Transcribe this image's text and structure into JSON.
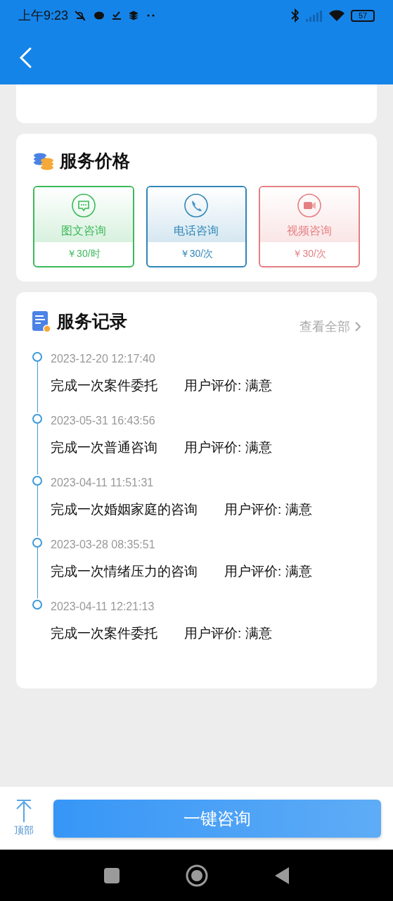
{
  "status_bar": {
    "time": "上午9:23",
    "battery": "57"
  },
  "price_section": {
    "title": "服务价格",
    "options": [
      {
        "kind": "chat",
        "label": "图文咨询",
        "price": "￥30/时",
        "color": "#3cb95a"
      },
      {
        "kind": "phone",
        "label": "电话咨询",
        "price": "￥30/次",
        "color": "#2f86b8"
      },
      {
        "kind": "video",
        "label": "视频咨询",
        "price": "￥30/次",
        "color": "#e57f82"
      }
    ]
  },
  "records_section": {
    "title": "服务记录",
    "view_all": "查看全部",
    "records": [
      {
        "time": "2023-12-20 12:17:40",
        "title": "完成一次案件委托",
        "rating": "用户评价: 满意"
      },
      {
        "time": "2023-05-31 16:43:56",
        "title": "完成一次普通咨询",
        "rating": "用户评价: 满意"
      },
      {
        "time": "2023-04-11 11:51:31",
        "title": "完成一次婚姻家庭的咨询",
        "rating": "用户评价: 满意"
      },
      {
        "time": "2023-03-28 08:35:51",
        "title": "完成一次情绪压力的咨询",
        "rating": "用户评价: 满意"
      },
      {
        "time": "2023-04-11 12:21:13",
        "title": "完成一次案件委托",
        "rating": "用户评价: 满意"
      }
    ]
  },
  "footer": {
    "top_label": "顶部",
    "consult_button": "一键咨询"
  }
}
